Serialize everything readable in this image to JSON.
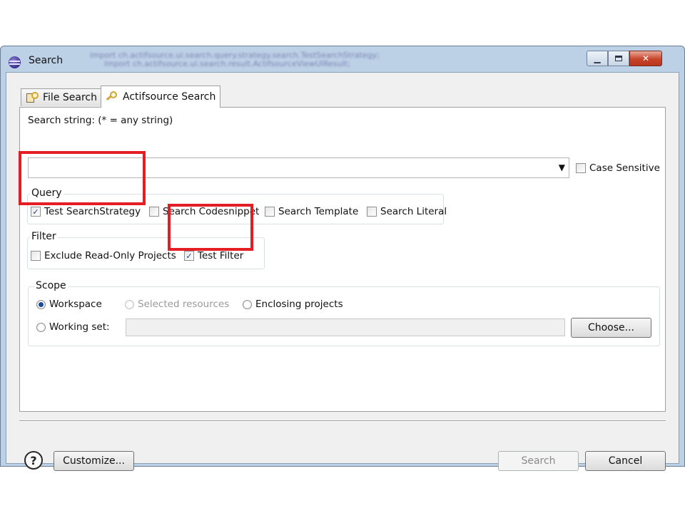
{
  "window": {
    "title": "Search",
    "blurred_background_lines": [
      "import ch.actifsource.ui.search.query.strategy.search.TestSearchStrategy;",
      "import ch.actifsource.ui.search.result.ActifsourceViewUIResult;"
    ]
  },
  "tabs": [
    {
      "label": "File Search",
      "icon": "file-search-icon",
      "selected": false
    },
    {
      "label": "Actifsource Search",
      "icon": "actifsource-search-icon",
      "selected": true
    }
  ],
  "search": {
    "label": "Search string: (* = any string)",
    "value": "",
    "case_sensitive_label": "Case Sensitive",
    "case_sensitive_checked": false
  },
  "query": {
    "title": "Query",
    "options": [
      {
        "label": "Test SearchStrategy",
        "checked": true
      },
      {
        "label": "Search Codesnippet",
        "checked": false
      },
      {
        "label": "Search Template",
        "checked": false
      },
      {
        "label": "Search Literal",
        "checked": false
      }
    ]
  },
  "filter": {
    "title": "Filter",
    "options": [
      {
        "label": "Exclude Read-Only Projects",
        "checked": false
      },
      {
        "label": "Test Filter",
        "checked": true
      }
    ]
  },
  "scope": {
    "title": "Scope",
    "workspace_label": "Workspace",
    "selected_resources_label": "Selected resources",
    "enclosing_projects_label": "Enclosing projects",
    "working_set_label": "Working set:",
    "working_set_value": "",
    "choose_label": "Choose...",
    "selected": "workspace"
  },
  "footer": {
    "help_icon": "help-icon",
    "customize_label": "Customize...",
    "search_label": "Search",
    "cancel_label": "Cancel"
  },
  "highlight_color": "#e41c24"
}
